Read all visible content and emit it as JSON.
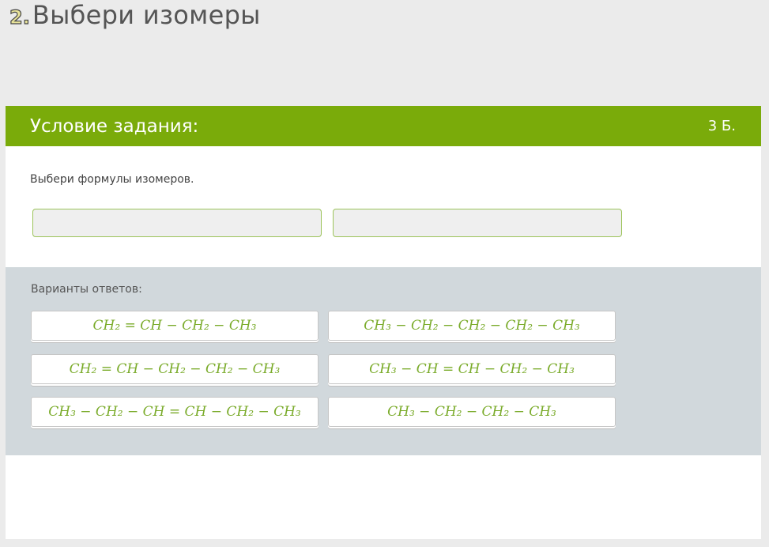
{
  "heading": {
    "number": "2.",
    "title": "Выбери изомеры"
  },
  "task": {
    "title": "Условие задания:",
    "points": "3 Б.",
    "prompt": "Выбери формулы изомеров.",
    "answers_label": "Варианты ответов:",
    "options": [
      "CH₂ = CH − CH₂ − CH₃",
      "CH₃ − CH₂ − CH₂ − CH₂ − CH₃",
      "CH₂ = CH − CH₂ − CH₂ − CH₃",
      "CH₃ − CH = CH − CH₂ − CH₃",
      "CH₃ − CH₂ − CH = CH − CH₂ − CH₃",
      "CH₃ − CH₂ − CH₂ − CH₃"
    ]
  },
  "colors": {
    "accent": "#7aab0a",
    "answers_bg": "#d1d8dc",
    "formula": "#7aab2a"
  }
}
